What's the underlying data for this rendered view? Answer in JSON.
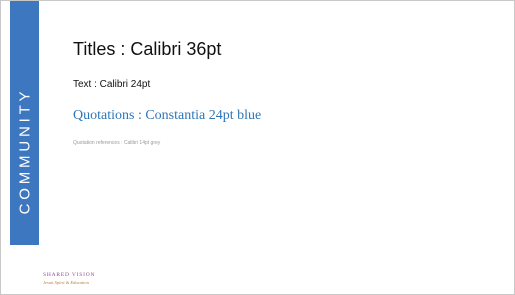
{
  "sidebar": {
    "label": "COMMUNITY",
    "color": "#3d77bf"
  },
  "content": {
    "title": "Titles : Calibri 36pt",
    "text": "Text : Calibri 24pt",
    "quotation": "Quotations : Constantia 24pt blue",
    "quotation_color": "#2e76b6",
    "reference": "Quotation references : Calibri 14pt grey",
    "reference_color": "#9a9a9a"
  },
  "logo": {
    "line1": "SHARED VISION",
    "line2": "Jesuit Spirit & Education"
  }
}
